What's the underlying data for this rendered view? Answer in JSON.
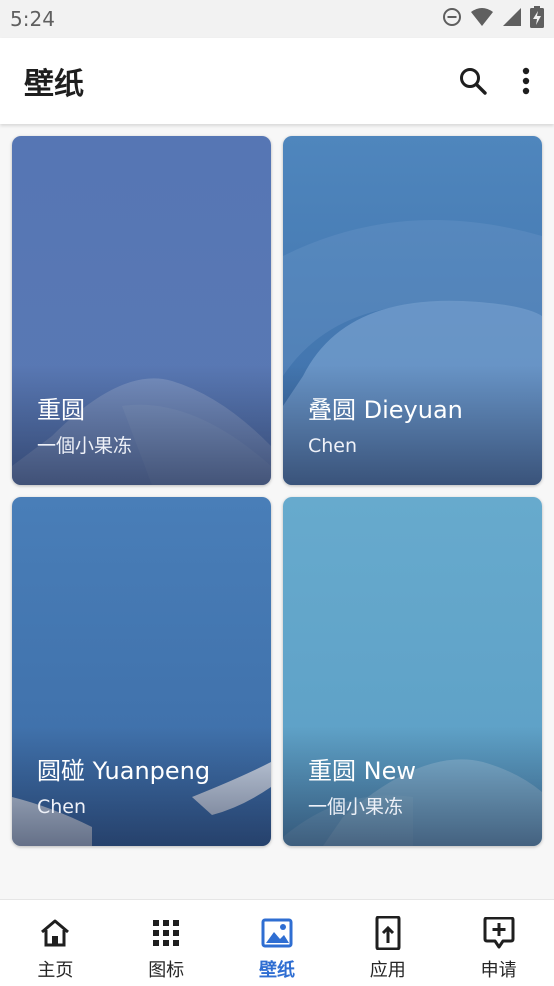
{
  "status_bar": {
    "time": "5:24",
    "icons": [
      "do-not-disturb-icon",
      "wifi-icon",
      "signal-icon",
      "battery-charging-icon"
    ]
  },
  "app_bar": {
    "title": "壁纸",
    "actions": [
      "search-icon",
      "more-vert-icon"
    ]
  },
  "wallpapers": [
    {
      "title": "重圆",
      "author": "一個小果冻",
      "colors": {
        "top": "#5676b4",
        "bottom": "#5a79b3",
        "accent": "#8ea2c8"
      }
    },
    {
      "title": "叠圆 Dieyuan",
      "author": "Chen",
      "colors": {
        "top": "#4f86bd",
        "bottom": "#3d6ea8",
        "accent": "#6d98c9"
      }
    },
    {
      "title": "圆碰 Yuanpeng",
      "author": "Chen",
      "colors": {
        "top": "#497eb8",
        "bottom": "#3c6ca6",
        "accent": "#dfe6ef"
      }
    },
    {
      "title": "重圆 New",
      "author": "一個小果冻",
      "colors": {
        "top": "#67aacd",
        "bottom": "#5b9ec5",
        "accent": "#9cc7de"
      }
    }
  ],
  "bottom_nav": {
    "items": [
      {
        "label": "主页",
        "icon": "home-icon",
        "active": false
      },
      {
        "label": "图标",
        "icon": "apps-grid-icon",
        "active": false
      },
      {
        "label": "壁纸",
        "icon": "wallpaper-icon",
        "active": true
      },
      {
        "label": "应用",
        "icon": "app-upload-icon",
        "active": false
      },
      {
        "label": "申请",
        "icon": "add-comment-icon",
        "active": false
      }
    ],
    "active_color": "#2f6ed2"
  }
}
